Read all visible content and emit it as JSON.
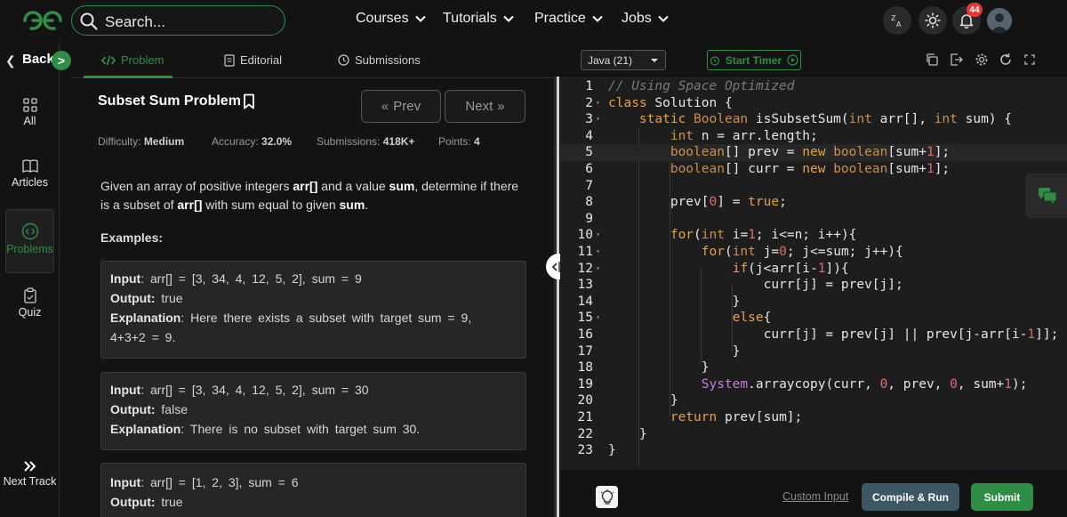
{
  "header": {
    "search_placeholder": "Search...",
    "nav": [
      "Courses",
      "Tutorials",
      "Practice",
      "Jobs"
    ],
    "notification_count": "44"
  },
  "rail": {
    "back_label": "Back",
    "items": [
      "All",
      "Articles",
      "Problems",
      "Quiz"
    ],
    "active": "Problems",
    "next_track": "Next Track"
  },
  "problem": {
    "tabs": [
      "Problem",
      "Editorial",
      "Submissions"
    ],
    "active_tab": "Problem",
    "title": "Subset Sum Problem",
    "prev_label": "Prev",
    "next_label": "Next",
    "meta": {
      "difficulty_label": "Difficulty:",
      "difficulty": "Medium",
      "accuracy_label": "Accuracy:",
      "accuracy": "32.0%",
      "submissions_label": "Submissions:",
      "submissions": "418K+",
      "points_label": "Points:",
      "points": "4"
    },
    "description": {
      "p1": "Given an array of positive integers ",
      "arr": "arr[]",
      "p2": " and a value ",
      "sum": "sum",
      "p3": ", determine if there is a subset of ",
      "arr2": "arr[]",
      "p4": " with sum equal to given ",
      "sum2": "sum",
      "p5": "."
    },
    "examples_heading": "Examples:",
    "examples": [
      {
        "input_label": "Input",
        "input": ": arr[] = [3, 34, 4, 12, 5, 2], sum = 9",
        "output_label": "Output:",
        "output": " true",
        "explanation_label": "Explanation",
        "explanation": ": Here there exists a subset with target sum = 9,",
        "explanation2": "4+3+2 = 9."
      },
      {
        "input_label": "Input",
        "input": ": arr[] = [3, 34, 4, 12, 5, 2], sum = 30",
        "output_label": "Output:",
        "output": " false",
        "explanation_label": "Explanation",
        "explanation": ": There is no subset with target sum 30."
      },
      {
        "input_label": "Input",
        "input": ": arr[] = [1, 2, 3], sum = 6",
        "output_label": "Output:",
        "output": " true"
      }
    ]
  },
  "editor": {
    "language": "Java (21)",
    "timer_label": "Start Timer",
    "line_numbers": [
      "1",
      "2",
      "3",
      "4",
      "5",
      "6",
      "7",
      "8",
      "9",
      "10",
      "11",
      "12",
      "13",
      "14",
      "15",
      "16",
      "17",
      "18",
      "19",
      "20",
      "21",
      "22",
      "23"
    ],
    "code": {
      "l1": "// Using Space Optimized",
      "l2a": "class",
      "l2b": " Solution {",
      "l3a": "    ",
      "l3b": "static",
      "l3c": " ",
      "l3d": "Boolean",
      "l3e": " isSubsetSum(",
      "l3f": "int",
      "l3g": " arr[], ",
      "l3h": "int",
      "l3i": " sum) {",
      "l4a": "        ",
      "l4b": "int",
      "l4c": " n = arr.length;",
      "l5a": "        ",
      "l5b": "boolean",
      "l5c": "[] prev = ",
      "l5d": "new",
      "l5e": " ",
      "l5f": "boolean",
      "l5g": "[sum+",
      "l5h": "1",
      "l5i": "];",
      "l6a": "        ",
      "l6b": "boolean",
      "l6c": "[] curr = ",
      "l6d": "new",
      "l6e": " ",
      "l6f": "boolean",
      "l6g": "[sum+",
      "l6h": "1",
      "l6i": "];",
      "l8a": "        prev[",
      "l8b": "0",
      "l8c": "] = ",
      "l8d": "true",
      "l8e": ";",
      "l10a": "        ",
      "l10b": "for",
      "l10c": "(",
      "l10d": "int",
      "l10e": " i=",
      "l10f": "1",
      "l10g": "; i<=n; i++){",
      "l11a": "            ",
      "l11b": "for",
      "l11c": "(",
      "l11d": "int",
      "l11e": " j=",
      "l11f": "0",
      "l11g": "; j<=sum; j++){",
      "l12a": "                ",
      "l12b": "if",
      "l12c": "(j<arr[i-",
      "l12d": "1",
      "l12e": "]){",
      "l13": "                    curr[j] = prev[j];",
      "l14": "                }",
      "l15a": "                ",
      "l15b": "else",
      "l15c": "{",
      "l16a": "                    curr[j] = prev[j] || prev[j-arr[i-",
      "l16b": "1",
      "l16c": "]];",
      "l17": "                }",
      "l18": "            }",
      "l19a": "            ",
      "l19b": "System",
      "l19c": ".arraycopy(curr, ",
      "l19d": "0",
      "l19e": ", prev, ",
      "l19f": "0",
      "l19g": ", sum+",
      "l19h": "1",
      "l19i": ");",
      "l20": "        }",
      "l21a": "        ",
      "l21b": "return",
      "l21c": " prev[sum];",
      "l22": "    }",
      "l23": "}"
    },
    "custom_input": "Custom Input",
    "compile_run": "Compile & Run",
    "submit": "Submit"
  },
  "colors": {
    "accent": "#2f8d46",
    "badge": "#e53935",
    "run_button": "#3e5765"
  }
}
